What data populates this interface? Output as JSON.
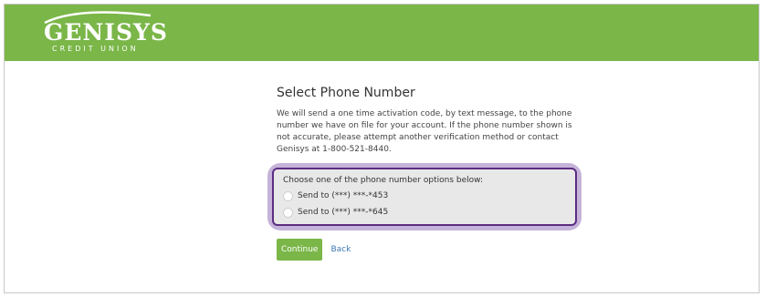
{
  "header": {
    "brand_name": "GENISYS",
    "brand_sub": "CREDIT UNION"
  },
  "main": {
    "title": "Select Phone Number",
    "description": "We will send a one time activation code, by text message, to the phone number we have on file for your account. If the phone number shown is not accurate, please attempt another verification method or contact Genisys at 1-800-521-8440.",
    "options_heading": "Choose one of the phone number options below:",
    "options": [
      {
        "label": "Send to (***) ***-*453"
      },
      {
        "label": "Send to (***) ***-*645"
      }
    ],
    "continue_label": "Continue",
    "back_label": "Back"
  },
  "colors": {
    "brand_green": "#7ab648",
    "highlight_purple": "#5b2d82",
    "link_blue": "#3c78b4"
  }
}
